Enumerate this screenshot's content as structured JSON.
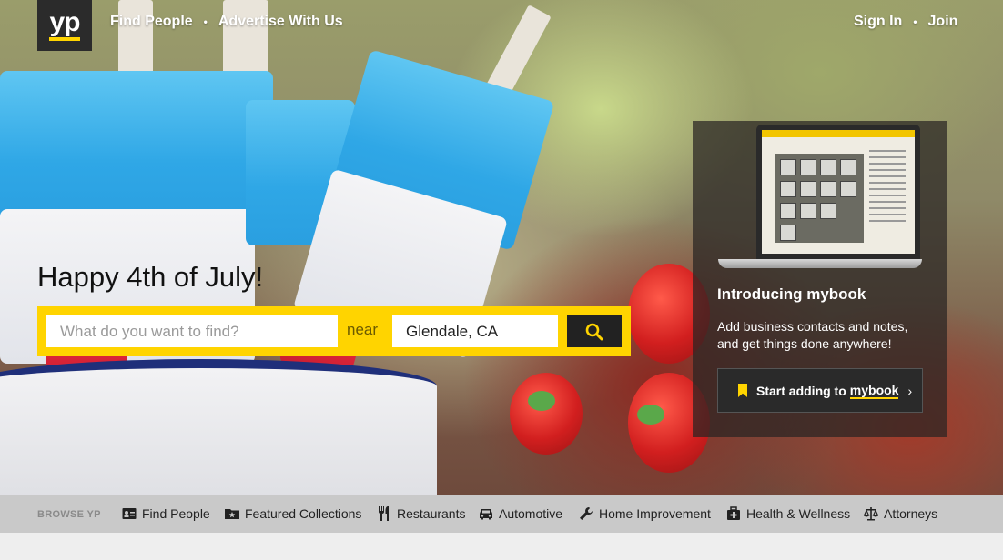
{
  "brand": {
    "logo_text": "yp",
    "accent": "#ffd400",
    "dark": "#2b2b2b"
  },
  "topnav": {
    "left": [
      {
        "label": "Find People"
      },
      {
        "label": "Advertise With Us"
      }
    ],
    "right": [
      {
        "label": "Sign In"
      },
      {
        "label": "Join"
      }
    ],
    "separator": "•"
  },
  "hero": {
    "headline": "Happy 4th of July!"
  },
  "search": {
    "what_placeholder": "What do you want to find?",
    "what_value": "",
    "near_label": "near",
    "where_value": "Glendale, CA",
    "button_icon": "search-icon"
  },
  "promo": {
    "title": "Introducing mybook",
    "description": "Add business contacts and notes, and get things done anywhere!",
    "button_prefix": "Start adding to",
    "button_brand": "mybook",
    "button_chevron": "›",
    "button_icon": "bookmark-icon"
  },
  "browse": {
    "label": "BROWSE YP",
    "items": [
      {
        "label": "Find People",
        "icon": "id-card-icon"
      },
      {
        "label": "Featured Collections",
        "icon": "star-folder-icon"
      },
      {
        "label": "Restaurants",
        "icon": "fork-knife-icon"
      },
      {
        "label": "Automotive",
        "icon": "car-icon"
      },
      {
        "label": "Home Improvement",
        "icon": "wrench-icon"
      },
      {
        "label": "Health & Wellness",
        "icon": "medical-kit-icon"
      },
      {
        "label": "Attorneys",
        "icon": "scales-icon"
      }
    ]
  }
}
